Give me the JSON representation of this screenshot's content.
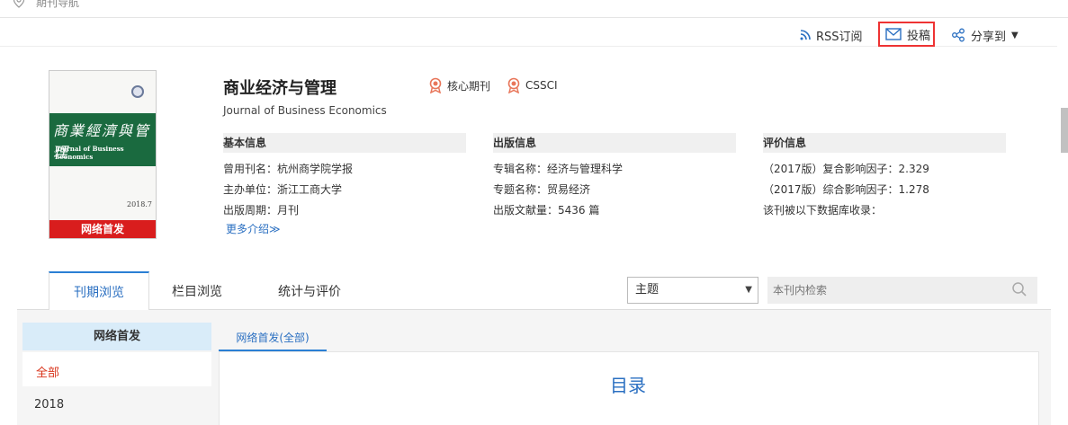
{
  "breadcrumb": {
    "label": "期刊导航"
  },
  "toolbar": {
    "rss": "RSS订阅",
    "submit": "投稿",
    "share": "分享到"
  },
  "journal": {
    "title": "商业经济与管理",
    "subtitle": "Journal of Business Economics",
    "badges": [
      "核心期刊",
      "CSSCI"
    ],
    "cover": {
      "title_cn": "商業經濟與管理",
      "title_en": "Journal of Business Economics",
      "date": "2018.7",
      "tag": "网络首发"
    }
  },
  "sections": {
    "basic": {
      "title": "基本信息",
      "rows": [
        {
          "k": "曾用刊名：",
          "v": "杭州商学院学报"
        },
        {
          "k": "主办单位：",
          "v": "浙江工商大学"
        },
        {
          "k": "出版周期：",
          "v": "月刊"
        }
      ]
    },
    "publish": {
      "title": "出版信息",
      "rows": [
        {
          "k": "专辑名称：",
          "v": "经济与管理科学"
        },
        {
          "k": "专题名称：",
          "v": "贸易经济"
        },
        {
          "k": "出版文献量：",
          "v": "5436 篇"
        }
      ]
    },
    "eval": {
      "title": "评价信息",
      "rows": [
        {
          "k": "（2017版）复合影响因子：",
          "v": "2.329"
        },
        {
          "k": "（2017版）综合影响因子：",
          "v": "1.278"
        },
        {
          "k": "该刊被以下数据库收录：",
          "v": ""
        }
      ]
    },
    "more": "更多介绍≫"
  },
  "tabs": [
    "刊期浏览",
    "栏目浏览",
    "统计与评价"
  ],
  "search": {
    "scope": "主题",
    "placeholder": "本刊内检索"
  },
  "sidebar": {
    "header": "网络首发",
    "items": [
      "全部",
      "2018"
    ]
  },
  "main": {
    "subtab": "网络首发(全部)",
    "toc_title": "目录"
  },
  "colors": {
    "accent": "#2a7fd4",
    "highlight_border": "#e33",
    "cover_green": "#1a6a3f",
    "tag_red": "#d91d1d"
  }
}
